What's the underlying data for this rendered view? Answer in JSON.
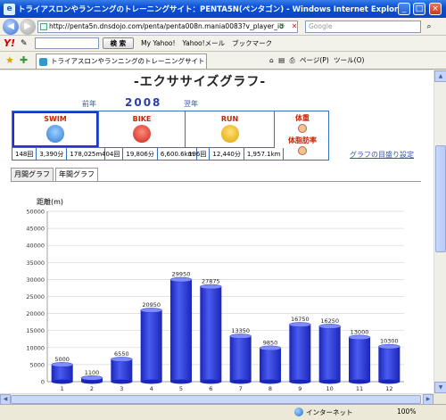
{
  "window": {
    "title": "トライアスロンやランニングのトレーニングサイト：PENTA5N(ペンタゴン) - Windows Internet Explorer",
    "minimize": "_",
    "maximize": "□",
    "close": "×"
  },
  "address_bar": {
    "url": "http://penta5n.dnsdojo.com/penta/penta008n.mania0083?v_player_id",
    "search_placeholder": "Google"
  },
  "yahoo_toolbar": {
    "logo": "Y!",
    "search_button": "検 索",
    "items": [
      "My Yahoo!",
      "Yahoo!メール",
      "ブックマーク"
    ]
  },
  "browser_tab": {
    "label": "トライアスロンやランニングのトレーニングサイト：PENTA5N..."
  },
  "tab_tools": {
    "page_menu": "ページ(P)",
    "tools_menu": "ツール(O)"
  },
  "page": {
    "title": "-エクササイズグラフ-",
    "prev_year": "前年",
    "year": "2008",
    "next_year": "翌年",
    "sports": [
      {
        "label": "SWIM",
        "count": "148回",
        "time": "3,390分",
        "distance": "178,025m"
      },
      {
        "label": "BIKE",
        "count": "404回",
        "time": "19,806分",
        "distance": "6,600.6km"
      },
      {
        "label": "RUN",
        "count": "196回",
        "time": "12,440分",
        "distance": "1,957.1km"
      }
    ],
    "side_metrics": [
      "体重",
      "体脂肪率"
    ],
    "settings_link": "グラフの目盛り設定",
    "tabs": [
      "月間グラフ",
      "年間グラフ"
    ]
  },
  "status_bar": {
    "zone": "インターネット",
    "zoom": "100%"
  },
  "colors": {
    "bar_top": "#4a5cf0",
    "bar_dark": "#1a26b8",
    "link": "#3355aa",
    "sport_label": "#cc2200"
  },
  "chart_data": {
    "type": "bar",
    "ylabel": "距離(m)",
    "ylim": [
      0,
      50000
    ],
    "yticks": [
      0,
      5000,
      10000,
      15000,
      20000,
      25000,
      30000,
      35000,
      40000,
      45000,
      50000
    ],
    "categories": [
      "1",
      "2",
      "3",
      "4",
      "5",
      "6",
      "7",
      "8",
      "9",
      "10",
      "11",
      "12"
    ],
    "values": [
      5000,
      1100,
      6550,
      20950,
      29950,
      27875,
      13350,
      9850,
      16750,
      16250,
      13000,
      10300
    ],
    "grid": true
  }
}
